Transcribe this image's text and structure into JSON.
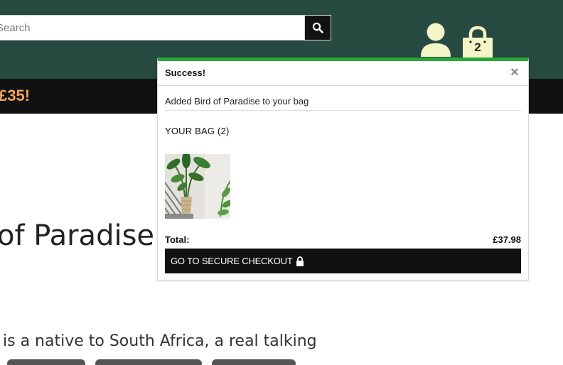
{
  "header": {
    "search": {
      "placeholder": "Search",
      "value": ""
    },
    "search_button_icon": "search-icon",
    "account_icon": "user-icon",
    "bag_icon": "shopping-bag-icon",
    "bag_count": "2"
  },
  "promo": {
    "text": "£35!"
  },
  "product": {
    "title": "of Paradise",
    "description": "is a native to South Africa, a real talking"
  },
  "toast": {
    "title": "Success!",
    "close_symbol": "×",
    "message": "Added Bird of Paradise to your bag",
    "bag_heading": "YOUR BAG (2)",
    "thumbnail": "bird-of-paradise-plant-image",
    "total_label": "Total:",
    "total_value": "£37.98",
    "checkout_label": "GO TO SECURE CHECKOUT",
    "checkout_icon": "lock-icon"
  },
  "colors": {
    "header_bg": "#274a40",
    "promo_bg": "#111111",
    "promo_text": "#f0a35e",
    "success_accent": "#2ba73a",
    "icon_fill": "#f4f5c8",
    "button_bg": "#111111"
  }
}
